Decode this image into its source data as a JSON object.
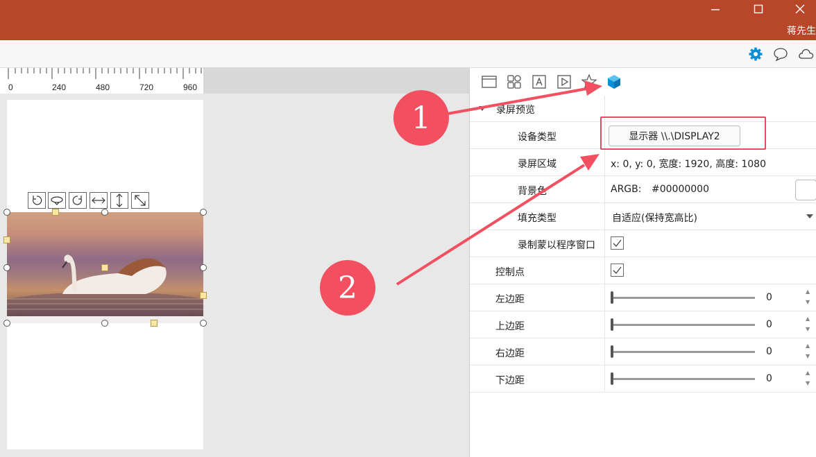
{
  "window": {
    "minimize_icon": "minimize-icon",
    "maximize_icon": "maximize-icon",
    "close_icon": "close-icon",
    "user_name": "蒋先生",
    "title_color": "#b8472a"
  },
  "toolbar": {
    "icons": [
      "gear-icon",
      "comment-icon",
      "cloud-icon"
    ],
    "accent": "#0a8fd6"
  },
  "ruler": {
    "labels": [
      "0",
      "240",
      "480",
      "720",
      "960"
    ]
  },
  "canvas": {
    "transform_tools": [
      "rotate-left-icon",
      "flip-vertical-icon",
      "rotate-right-icon",
      "flip-horizontal-icon",
      "resize-vertical-icon",
      "resize-diagonal-icon"
    ]
  },
  "panel": {
    "tabs": [
      "window-icon",
      "grid-icon",
      "text-icon",
      "play-icon",
      "star-icon",
      "cube-icon"
    ],
    "section_title": "录屏预览",
    "rows": {
      "device_type": {
        "label": "设备类型",
        "value": "显示器 \\\\.\\DISPLAY2"
      },
      "record_area": {
        "label": "录屏区域",
        "value": "x: 0, y: 0, 宽度: 1920, 高度: 1080"
      },
      "background": {
        "label": "背景色",
        "prefix": "ARGB:",
        "value": "#00000000"
      },
      "fill_type": {
        "label": "填充类型",
        "value": "自适应(保持宽高比)"
      },
      "record_mask": {
        "label": "录制蒙以程序窗口",
        "checked": true
      },
      "control_points": {
        "label": "控制点",
        "checked": true
      },
      "left_margin": {
        "label": "左边距",
        "value": "0"
      },
      "top_margin": {
        "label": "上边距",
        "value": "0"
      },
      "right_margin": {
        "label": "右边距",
        "value": "0"
      },
      "bottom_margin": {
        "label": "下边距",
        "value": "0"
      }
    }
  },
  "callouts": [
    "1",
    "2"
  ],
  "callout_color": "#f24f60"
}
